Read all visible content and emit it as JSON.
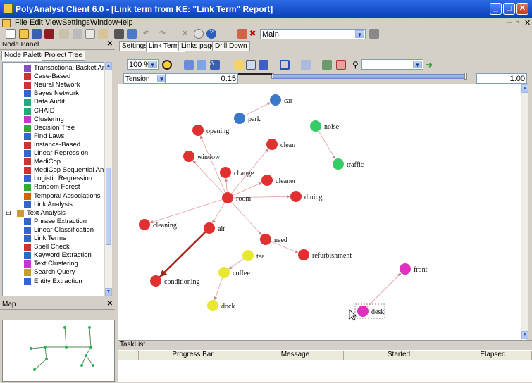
{
  "title": "PolyAnalyst Client 6.0 - [Link term from KE: \"Link Term\" Report]",
  "menu": [
    "File",
    "Edit",
    "View",
    "Settings",
    "Window",
    "Help"
  ],
  "toolbar": {
    "workspace_value": "Main"
  },
  "node_panel": {
    "title": "Node Panel",
    "tabs": [
      "Node Palette",
      "Project Tree"
    ],
    "items": [
      {
        "label": "Transactional Basket Anal",
        "level": 2,
        "color": "#8a4fbf"
      },
      {
        "label": "Case-Based",
        "level": 2,
        "color": "#c33"
      },
      {
        "label": "Neural Network",
        "level": 2,
        "color": "#c33"
      },
      {
        "label": "Bayes Network",
        "level": 2,
        "color": "#36c"
      },
      {
        "label": "Data Audit",
        "level": 2,
        "color": "#2a7"
      },
      {
        "label": "CHAID",
        "level": 2,
        "color": "#2a7"
      },
      {
        "label": "Clustering",
        "level": 2,
        "color": "#c3c"
      },
      {
        "label": "Decision Tree",
        "level": 2,
        "color": "#3a3"
      },
      {
        "label": "Find Laws",
        "level": 2,
        "color": "#36c"
      },
      {
        "label": "Instance-Based",
        "level": 2,
        "color": "#c33"
      },
      {
        "label": "Linear Regression",
        "level": 2,
        "color": "#36c"
      },
      {
        "label": "MediCop",
        "level": 2,
        "color": "#c33"
      },
      {
        "label": "MediCop Sequential Analy",
        "level": 2,
        "color": "#c33"
      },
      {
        "label": "Logistic Regression",
        "level": 2,
        "color": "#36c"
      },
      {
        "label": "Random Forest",
        "level": 2,
        "color": "#3a3"
      },
      {
        "label": "Temporal Associations",
        "level": 2,
        "color": "#c60"
      },
      {
        "label": "Link Analysis",
        "level": 2,
        "color": "#36c"
      },
      {
        "label": "Text Analysis",
        "level": 1,
        "color": "#c93"
      },
      {
        "label": "Phrase Extraction",
        "level": 2,
        "color": "#36c"
      },
      {
        "label": "Linear Classification",
        "level": 2,
        "color": "#36c"
      },
      {
        "label": "Link Terms",
        "level": 2,
        "color": "#36c"
      },
      {
        "label": "Spell Check",
        "level": 2,
        "color": "#c33"
      },
      {
        "label": "Keyword Extraction",
        "level": 2,
        "color": "#36c"
      },
      {
        "label": "Text Clustering",
        "level": 2,
        "color": "#c3c"
      },
      {
        "label": "Search Query",
        "level": 2,
        "color": "#c93"
      },
      {
        "label": "Entity Extraction",
        "level": 2,
        "color": "#36c"
      }
    ]
  },
  "map_panel": {
    "title": "Map"
  },
  "main": {
    "tabs": [
      "Settings",
      "Link Terms",
      "Links page",
      "Drill Down"
    ],
    "active_tab": 1,
    "zoom_value": "100 %",
    "tension_label": "Tension",
    "tension_min": "0.15",
    "tension_max": "1.00",
    "search_value": ""
  },
  "graph": {
    "nodes": [
      {
        "id": "car",
        "label": "car",
        "color": "#3a78c9"
      },
      {
        "id": "park",
        "label": "park",
        "color": "#3a78c9"
      },
      {
        "id": "noise",
        "label": "noise",
        "color": "#33cc66"
      },
      {
        "id": "traffic",
        "label": "traffic",
        "color": "#33cc66"
      },
      {
        "id": "opening",
        "label": "opening",
        "color": "#e03030"
      },
      {
        "id": "window",
        "label": "window",
        "color": "#e03030"
      },
      {
        "id": "clean",
        "label": "clean",
        "color": "#e03030"
      },
      {
        "id": "change",
        "label": "change",
        "color": "#e03030"
      },
      {
        "id": "cleaner",
        "label": "cleaner",
        "color": "#e03030"
      },
      {
        "id": "room",
        "label": "room",
        "color": "#e03030"
      },
      {
        "id": "dining",
        "label": "dining",
        "color": "#e03030"
      },
      {
        "id": "cleaning",
        "label": "cleaning",
        "color": "#e03030"
      },
      {
        "id": "air",
        "label": "air",
        "color": "#e03030"
      },
      {
        "id": "need",
        "label": "need",
        "color": "#e03030"
      },
      {
        "id": "refurbishment",
        "label": "refurbishment",
        "color": "#e03030"
      },
      {
        "id": "tea",
        "label": "tea",
        "color": "#e8e830"
      },
      {
        "id": "coffee",
        "label": "coffee",
        "color": "#e8e830"
      },
      {
        "id": "dock",
        "label": "dock",
        "color": "#e8e830"
      },
      {
        "id": "conditioning",
        "label": "conditioning",
        "color": "#e03030"
      },
      {
        "id": "front",
        "label": "front",
        "color": "#e030c0"
      },
      {
        "id": "desk",
        "label": "desk",
        "color": "#e030c0"
      }
    ],
    "edges": [
      {
        "from": "park",
        "to": "car",
        "strong": false
      },
      {
        "from": "noise",
        "to": "traffic",
        "strong": false
      },
      {
        "from": "room",
        "to": "opening",
        "strong": false
      },
      {
        "from": "room",
        "to": "window",
        "strong": false
      },
      {
        "from": "room",
        "to": "clean",
        "strong": false
      },
      {
        "from": "room",
        "to": "change",
        "strong": false
      },
      {
        "from": "room",
        "to": "cleaner",
        "strong": false
      },
      {
        "from": "room",
        "to": "dining",
        "strong": false
      },
      {
        "from": "room",
        "to": "cleaning",
        "strong": false
      },
      {
        "from": "room",
        "to": "air",
        "strong": false
      },
      {
        "from": "room",
        "to": "need",
        "strong": false
      },
      {
        "from": "need",
        "to": "refurbishment",
        "strong": false
      },
      {
        "from": "tea",
        "to": "coffee",
        "strong": false
      },
      {
        "from": "coffee",
        "to": "dock",
        "strong": false
      },
      {
        "from": "air",
        "to": "conditioning",
        "strong": true
      },
      {
        "from": "desk",
        "to": "front",
        "strong": false
      }
    ],
    "selected": "desk"
  },
  "tasklist": {
    "title": "TaskList",
    "columns": [
      "",
      "Progress Bar",
      "Message",
      "Started",
      "Elapsed"
    ]
  }
}
